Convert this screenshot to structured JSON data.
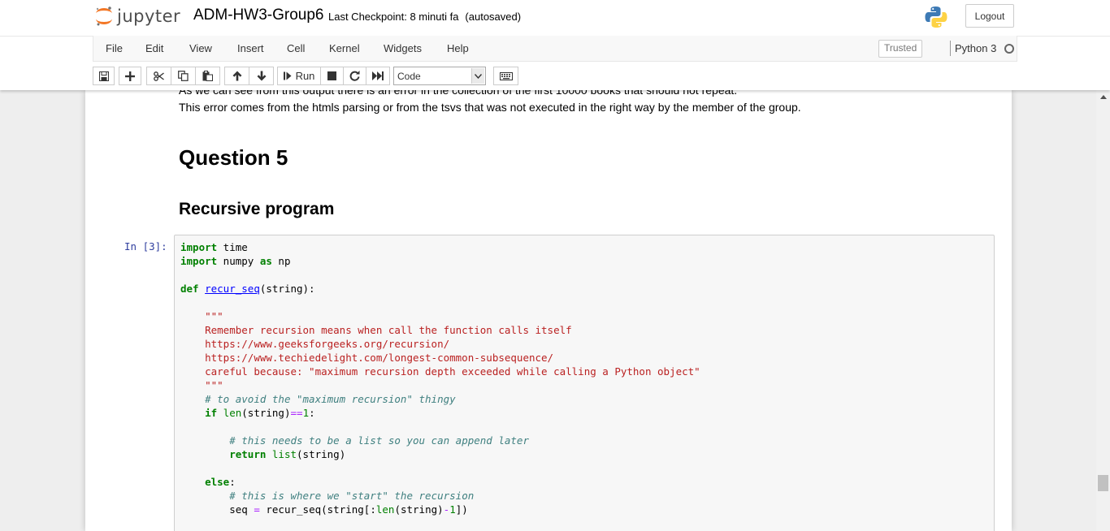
{
  "header": {
    "logo_text": "jupyter",
    "notebook_name": "ADM-HW3-Group6",
    "checkpoint_label": "Last Checkpoint: 8 minuti fa",
    "autosave_status": "(autosaved)",
    "logout_label": "Logout"
  },
  "menubar": {
    "items": [
      "File",
      "Edit",
      "View",
      "Insert",
      "Cell",
      "Kernel",
      "Widgets",
      "Help"
    ],
    "trusted_label": "Trusted",
    "kernel_name": "Python 3"
  },
  "toolbar": {
    "buttons": [
      "save-icon",
      "plus-icon",
      "cut-icon",
      "copy-icon",
      "paste-icon",
      "arrow-up-icon",
      "arrow-down-icon",
      "run-icon",
      "stop-icon",
      "restart-icon",
      "fast-forward-icon",
      "keyboard-icon"
    ],
    "run_label": "Run",
    "cell_type": "Code"
  },
  "notebook": {
    "md_partial_line": "As we can see from this output there is an error in the collection of the first 10000 books that should not repeat.",
    "md_line2": "This error comes from the htmls parsing or from the tsvs that was not executed in the right way by the member of the group.",
    "heading1": "Question 5",
    "heading2": "Recursive program",
    "cell_prompt": "In [3]:",
    "code": {
      "imp1": "import",
      "mod1": " time",
      "imp2": "import",
      "mod2": " numpy ",
      "as": "as",
      "alias": " np",
      "def": "def",
      "fname": "recur_seq",
      "params": "(string):",
      "doc_open": "\"\"\"",
      "doc1": "Remember recursion means when call the function calls itself",
      "doc2": "https://www.geeksforgeeks.org/recursion/",
      "doc3": "https://www.techiedelight.com/longest-common-subsequence/",
      "doc4": "careful because: \"maximum recursion depth exceeded while calling a Python object\"",
      "doc_close": "\"\"\"",
      "c1": "# to avoid the \"maximum recursion\" thingy",
      "if": "if",
      "len1": "len",
      "cond": "(string)",
      "eqop": "==",
      "one": "1",
      "colon": ":",
      "c2": "# this needs to be a list so you can append later",
      "return": "return",
      "list": "list",
      "ret_arg": "(string)",
      "else": "else",
      "else_colon": ":",
      "c3": "# this is where we \"start\" the recursion",
      "seq": "seq ",
      "assign": "=",
      "call": " recur_seq(string[:",
      "len2": "len",
      "call2": "(string)",
      "minus": "-",
      "one2": "1",
      "call_end": "])"
    }
  },
  "colors": {
    "prompt": "#303f9f",
    "keyword": "#008000",
    "string": "#ba2121",
    "comment": "#408080",
    "operator": "#aa22ff",
    "function": "#0000ff"
  }
}
